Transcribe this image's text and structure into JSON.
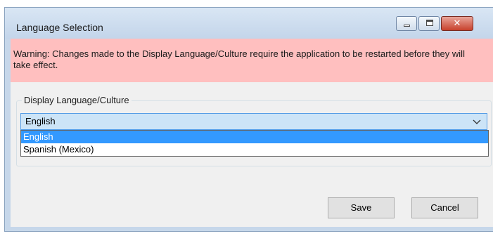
{
  "window": {
    "title": "Language Selection",
    "close_glyph": "✕"
  },
  "warning": {
    "text": "Warning: Changes made to the Display Language/Culture require the application to be restarted before they will take effect."
  },
  "language_group": {
    "label": "Display Language/Culture",
    "selected_value": "English",
    "options": [
      {
        "label": "English",
        "selected": true
      },
      {
        "label": "Spanish (Mexico)",
        "selected": false
      }
    ]
  },
  "buttons": {
    "save_label": "Save",
    "cancel_label": "Cancel"
  },
  "colors": {
    "warning_bg": "#ffbfbf",
    "selection_bg": "#3399ff",
    "combo_bg": "#cce4f7",
    "close_button": "#c7412c"
  },
  "icons": {
    "minimize": "minimize-icon",
    "maximize": "maximize-icon",
    "close": "close-icon",
    "dropdown": "chevron-down-icon"
  }
}
